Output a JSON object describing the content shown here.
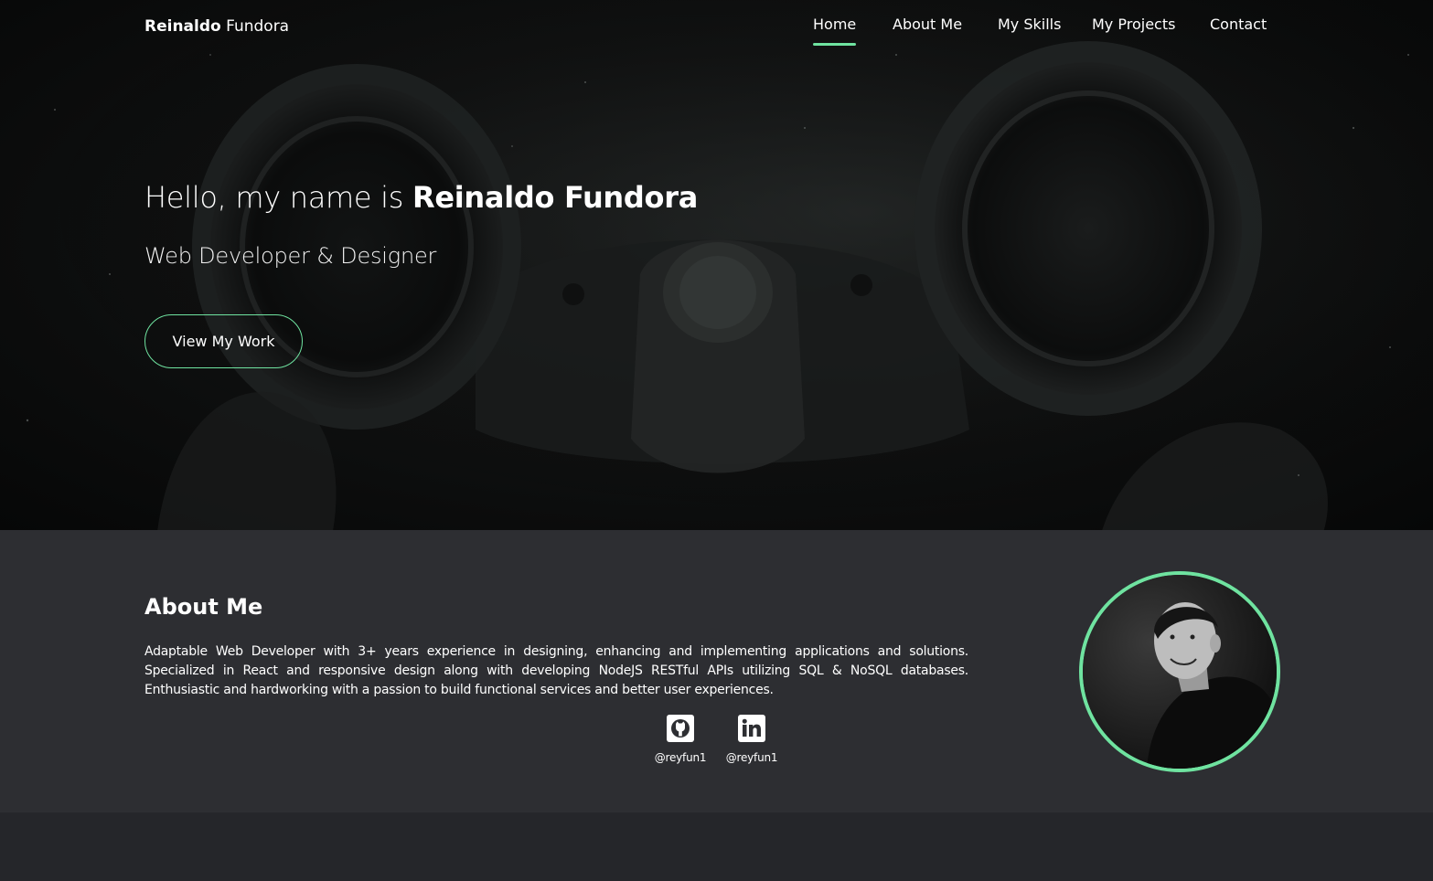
{
  "header": {
    "logo_first": "Reinaldo",
    "logo_last": " Fundora",
    "nav": [
      {
        "label": "Home",
        "active": true
      },
      {
        "label": "About Me",
        "active": false
      },
      {
        "label": "My Skills",
        "active": false
      },
      {
        "label": "My Projects",
        "active": false
      },
      {
        "label": "Contact",
        "active": false
      }
    ]
  },
  "hero": {
    "greeting": "Hello, my name is ",
    "name": "Reinaldo Fundora",
    "subtitle": "Web Developer & Designer",
    "cta_label": "View My Work"
  },
  "about": {
    "title": "About Me",
    "text": "Adaptable Web Developer with 3+ years experience in designing, enhancing and implementing applications and solutions. Specialized in React and responsive design along with developing NodeJS RESTful APIs utilizing SQL & NoSQL databases. Enthusiastic and hardworking with a passion to build functional services and better user experiences.",
    "socials": [
      {
        "icon": "github-icon",
        "handle": "@reyfun1"
      },
      {
        "icon": "linkedin-icon",
        "handle": "@reyfun1"
      }
    ]
  },
  "colors": {
    "accent": "#6fe3a0",
    "hero_bg": "#0a0b0b",
    "about_bg": "#2d2e32",
    "page_bg": "#25262a"
  }
}
